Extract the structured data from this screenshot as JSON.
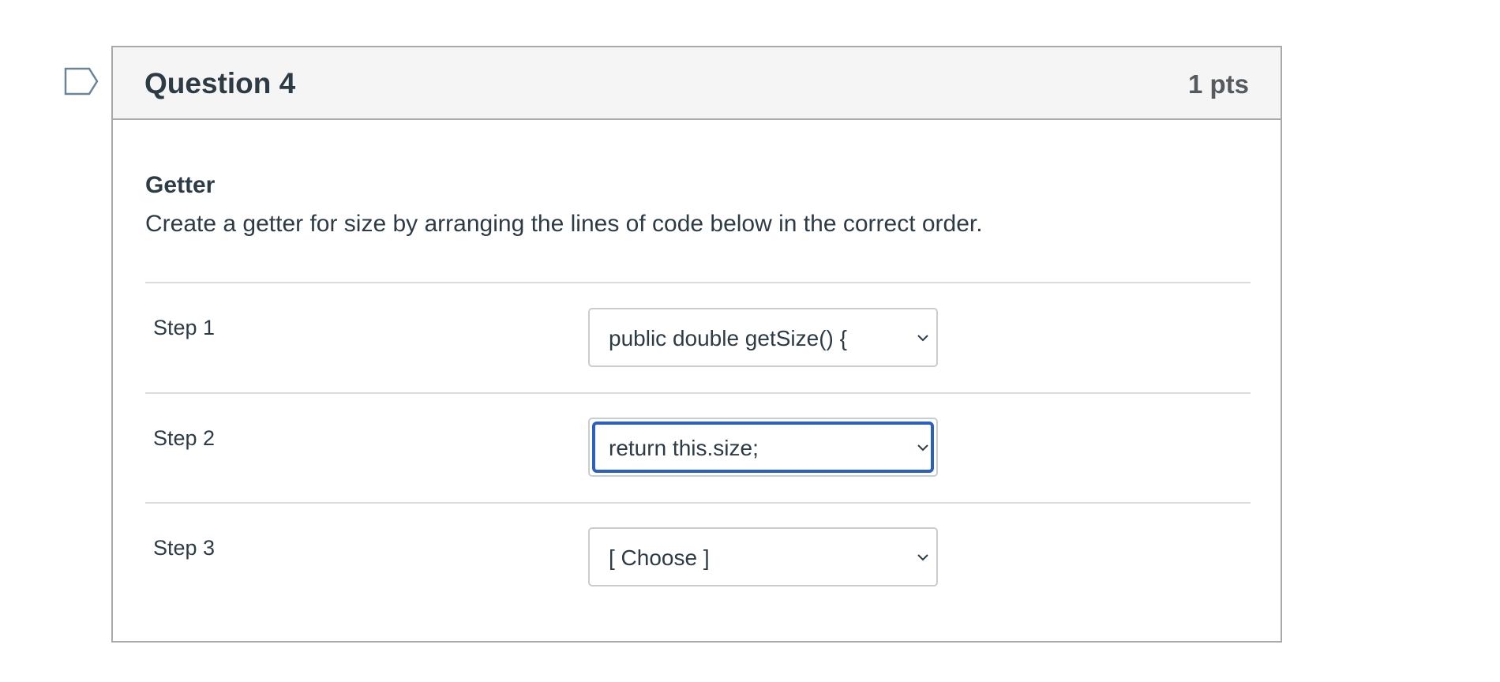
{
  "question": {
    "title": "Question 4",
    "points": "1 pts",
    "heading": "Getter",
    "text": "Create a getter for size by arranging the lines of code below in the correct order."
  },
  "steps": [
    {
      "label": "Step 1",
      "selected": "public double getSize() {"
    },
    {
      "label": "Step 2",
      "selected": "return this.size;"
    },
    {
      "label": "Step 3",
      "selected": "[ Choose ]"
    }
  ],
  "icons": {
    "flag": "bookmark-flag-icon",
    "chevron": "chevron-down-icon"
  },
  "colors": {
    "header_bg": "#f5f5f5",
    "border": "#a9a9a9",
    "focus": "#2b5fc0",
    "flag_stroke": "#6a8499"
  }
}
